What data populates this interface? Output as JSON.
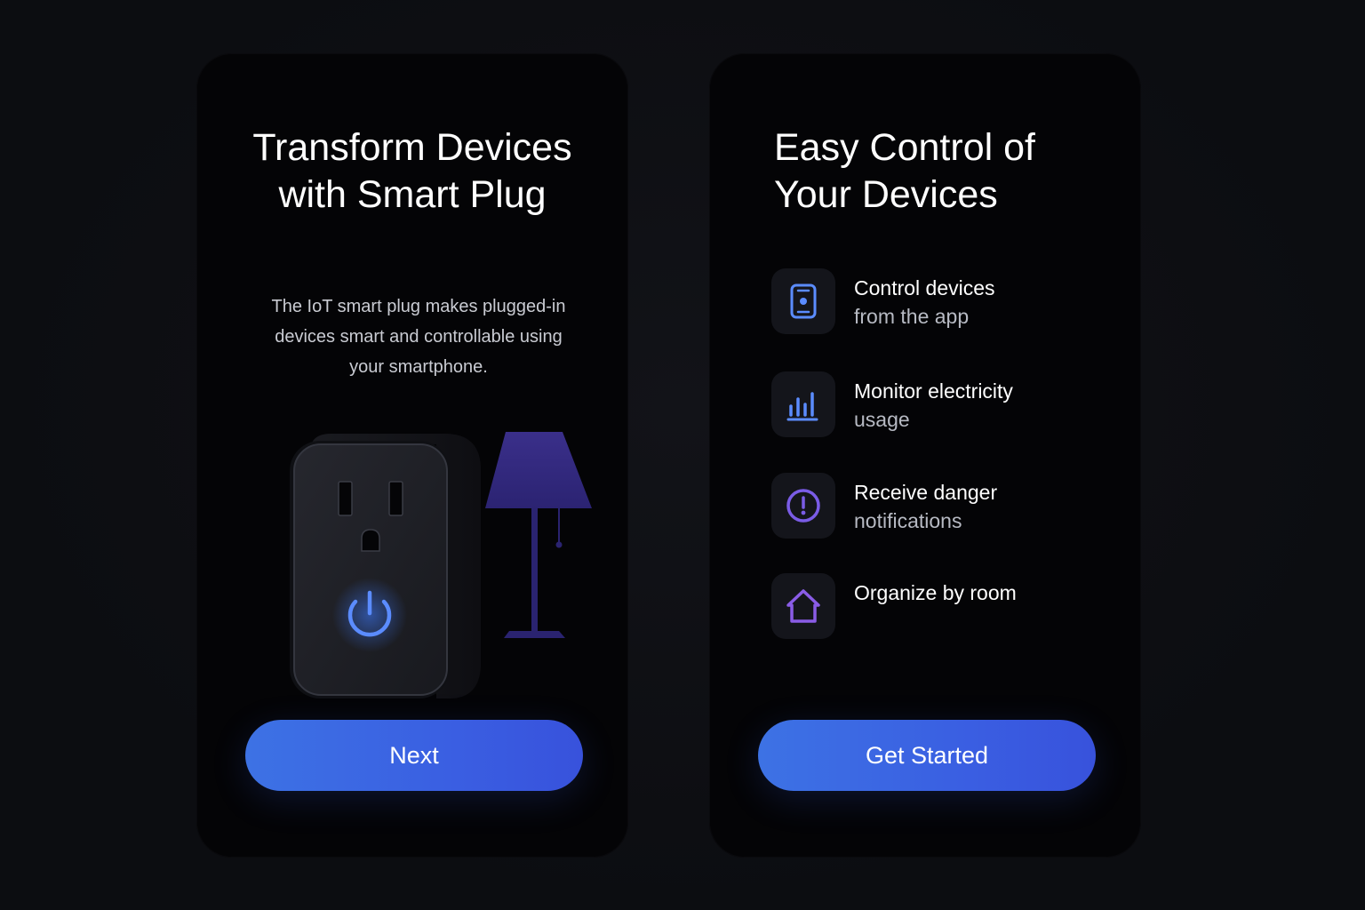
{
  "onboarding_step_1": {
    "title_line1": "Transform Devices",
    "title_line2": "with Smart Plug",
    "description_line1": "The IoT smart plug makes plugged-in",
    "description_line2": "devices smart and controllable using",
    "description_line3": "your smartphone.",
    "illustration": {
      "plug_icon": "smart-plug-icon",
      "power_icon": "power-icon",
      "lamp_icon": "floor-lamp-icon"
    },
    "button_label": "Next"
  },
  "onboarding_step_2": {
    "title_line1": "Easy Control of",
    "title_line2": "Your Devices",
    "features": [
      {
        "icon": "smartphone-icon",
        "line1": "Control devices",
        "line2": "from the app"
      },
      {
        "icon": "bar-chart-icon",
        "line1": "Monitor electricity",
        "line2": "usage"
      },
      {
        "icon": "alert-circle-icon",
        "line1": "Receive danger",
        "line2": "notifications"
      },
      {
        "icon": "home-icon",
        "line1": "Organize by room",
        "line2": ""
      }
    ],
    "button_label": "Get Started"
  },
  "colors": {
    "background": "#0d0e12",
    "card_background": "#040406",
    "accent_blue": "#3a5fe2",
    "accent_purple": "#7a5ce6",
    "icon_tile": "#14151b",
    "text_primary": "#ffffff",
    "text_secondary": "#b7bac3"
  }
}
